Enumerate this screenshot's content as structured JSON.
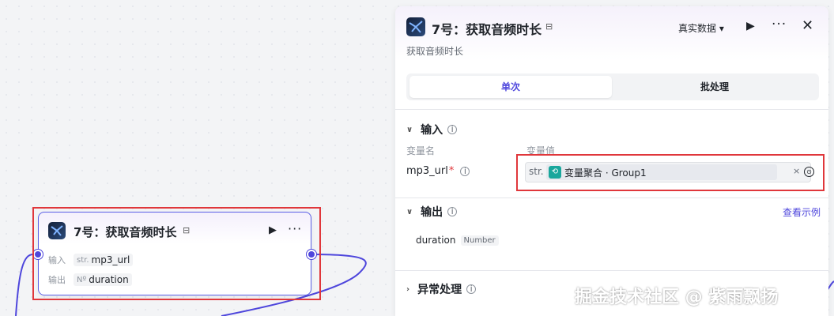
{
  "node": {
    "title": "7号：获取音频时长",
    "title_icon": "⊟",
    "run_icon": "▶",
    "more_icon": "···",
    "input_label": "输入",
    "input_type": "str.",
    "input_value": "mp3_url",
    "output_label": "输出",
    "output_type": "Nº",
    "output_value": "duration"
  },
  "panel": {
    "title": "7号：获取音频时长",
    "title_icon": "⊟",
    "subtitle": "获取音频时长",
    "data_mode": "真实数据 ▾",
    "run_icon": "▶",
    "more_icon": "···",
    "close_icon": "✕",
    "tabs": [
      {
        "label": "单次",
        "active": true
      },
      {
        "label": "批处理",
        "active": false
      }
    ],
    "input_section": {
      "title": "输入",
      "chevron": "∨",
      "info": "i",
      "col_name": "变量名",
      "col_value": "变量值",
      "var_name": "mp3_url",
      "required_mark": "*",
      "value_type": "str.",
      "value_icon": "⟲",
      "value_text": "变量聚合 · Group1",
      "clear_icon": "×",
      "picker_icon": "⊙"
    },
    "output_section": {
      "title": "输出",
      "chevron": "∨",
      "info": "i",
      "link": "查看示例",
      "field": "duration",
      "field_type": "Number"
    },
    "error_section": {
      "title": "异常处理",
      "chevron": "›",
      "info": "i"
    }
  },
  "watermark": "掘金技术社区 @ 紫雨飘扬",
  "colors": {
    "accent": "#4e46dc",
    "highlight": "#e0373b",
    "group_icon": "#19a79c"
  }
}
